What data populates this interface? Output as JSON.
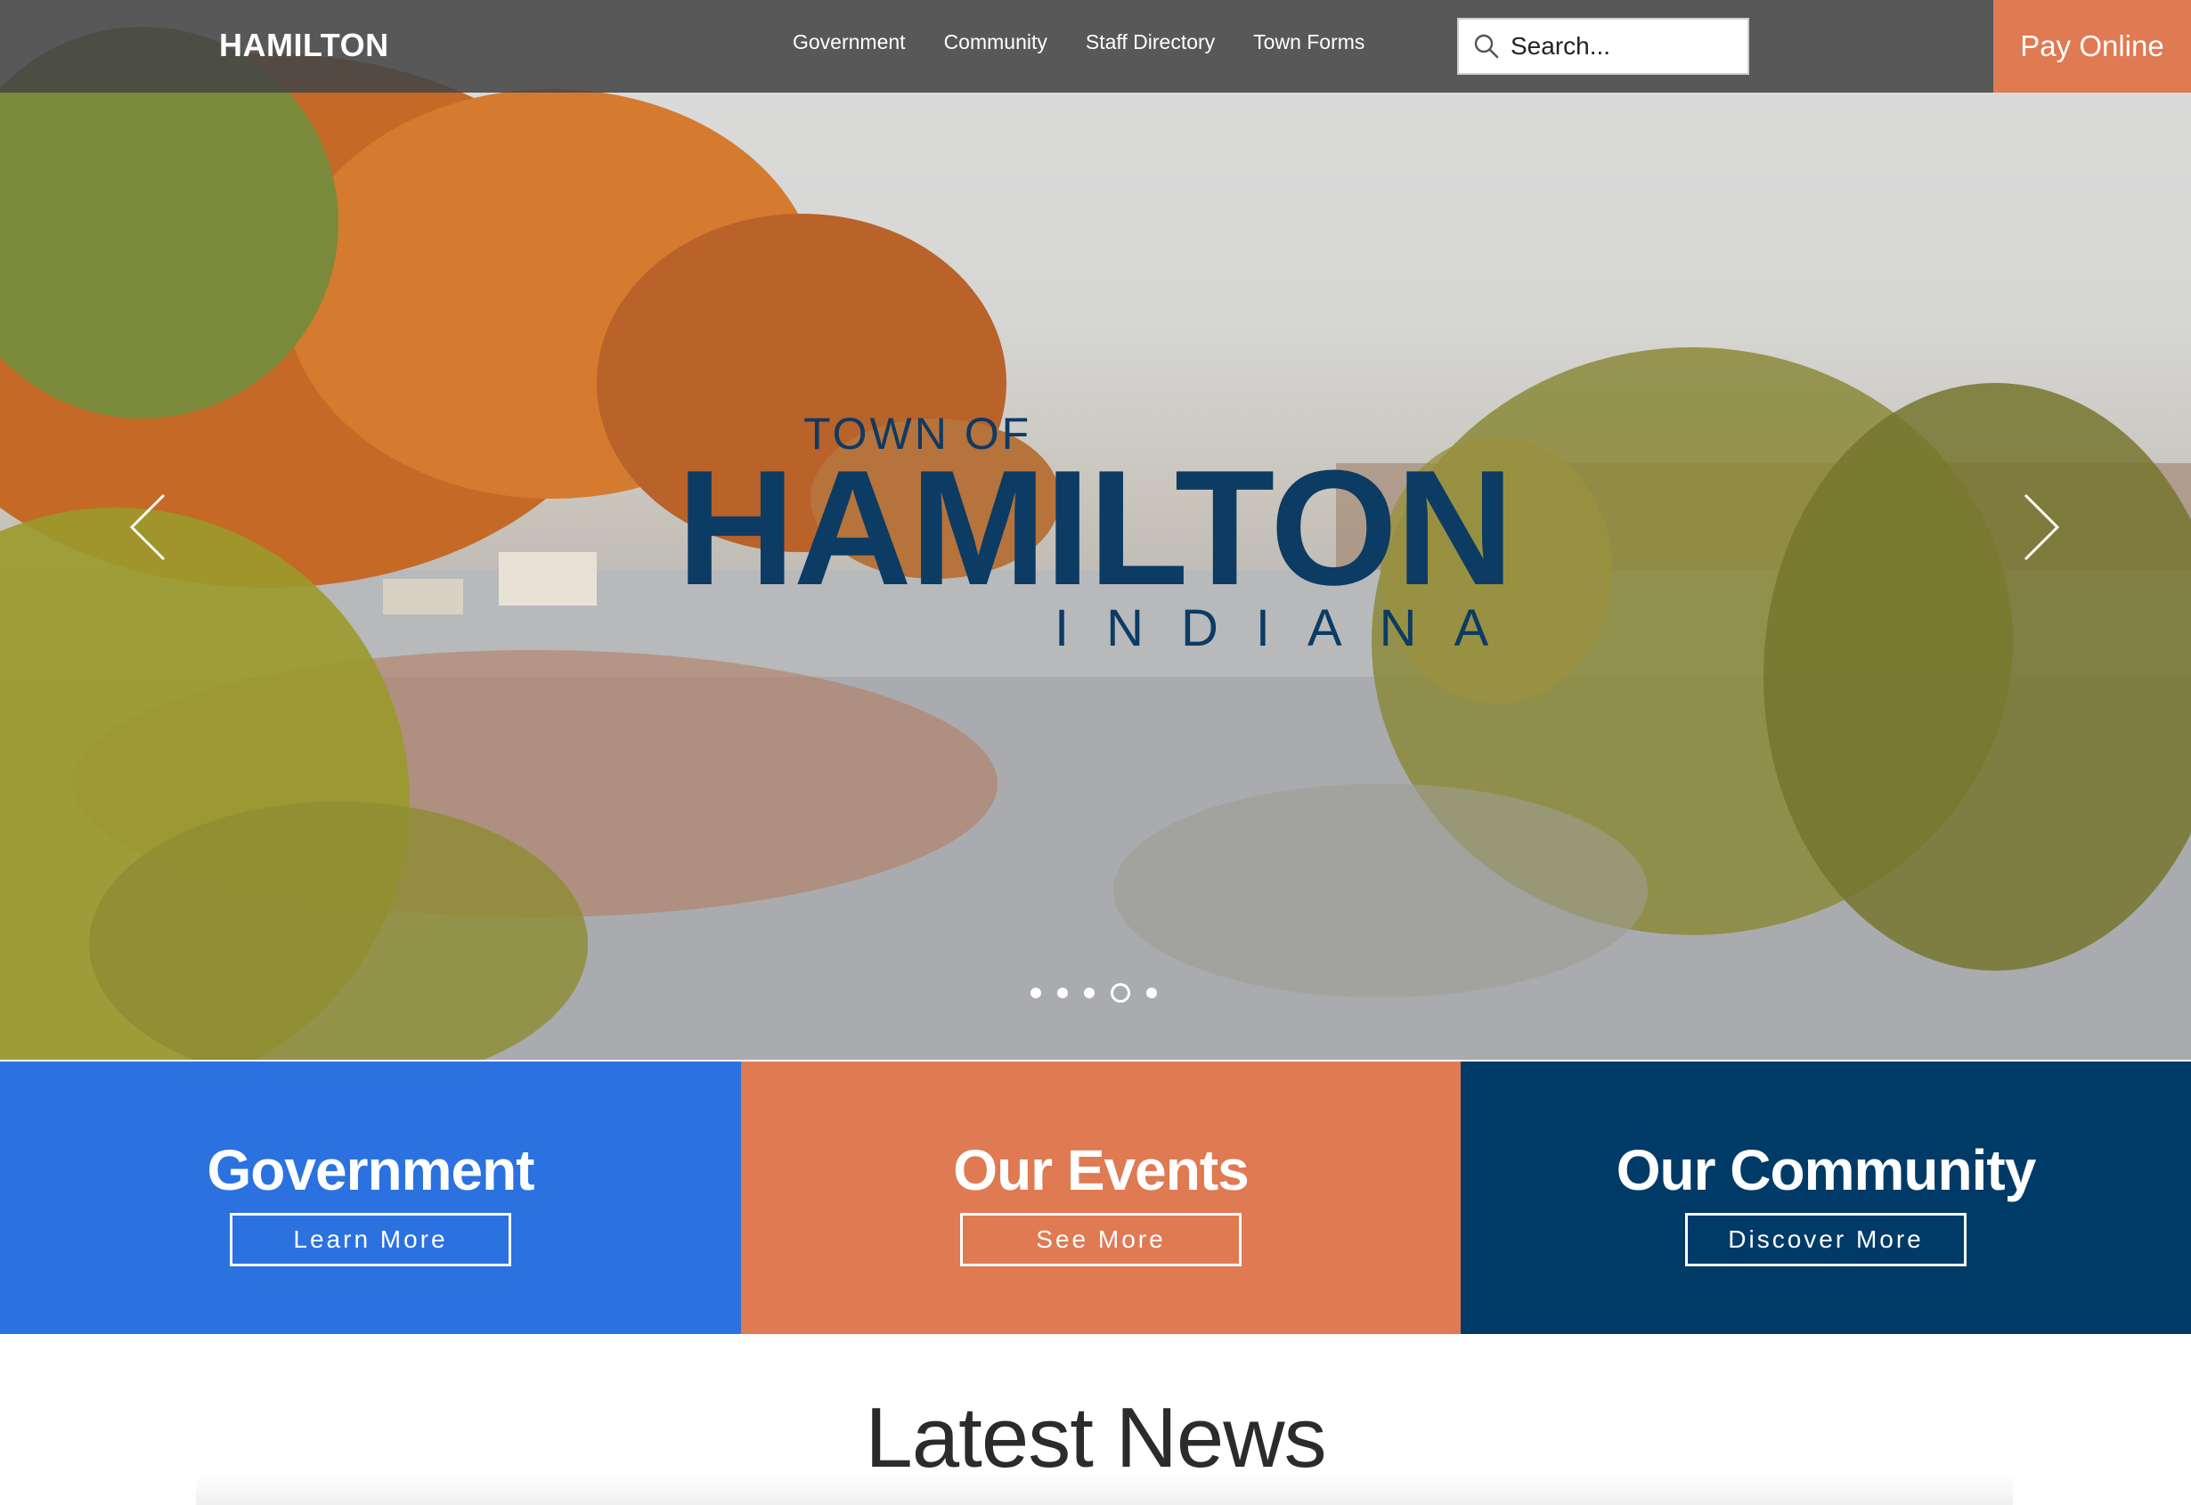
{
  "header": {
    "brand": "HAMILTON",
    "nav": [
      "Government",
      "Community",
      "Staff Directory",
      "Town Forms"
    ],
    "search": {
      "placeholder": "Search...",
      "icon": "search-icon"
    },
    "pay_online": "Pay Online"
  },
  "hero": {
    "logo_top": "TOWN OF",
    "logo_name": "HAMILTON",
    "logo_state": "INDIANA",
    "prev_icon": "chevron-left-icon",
    "next_icon": "chevron-right-icon",
    "slides_total": 5,
    "active_slide": 4
  },
  "panels": [
    {
      "title": "Government",
      "button": "Learn More",
      "color": "#2b72e0"
    },
    {
      "title": "Our Events",
      "button": "See More",
      "color": "#df7a53"
    },
    {
      "title": "Our Community",
      "button": "Discover More",
      "color": "#003b67"
    }
  ],
  "news": {
    "title": "Latest News"
  },
  "colors": {
    "header_bg": "#464646",
    "accent": "#df7a53",
    "logo_navy": "#0c3b64"
  }
}
